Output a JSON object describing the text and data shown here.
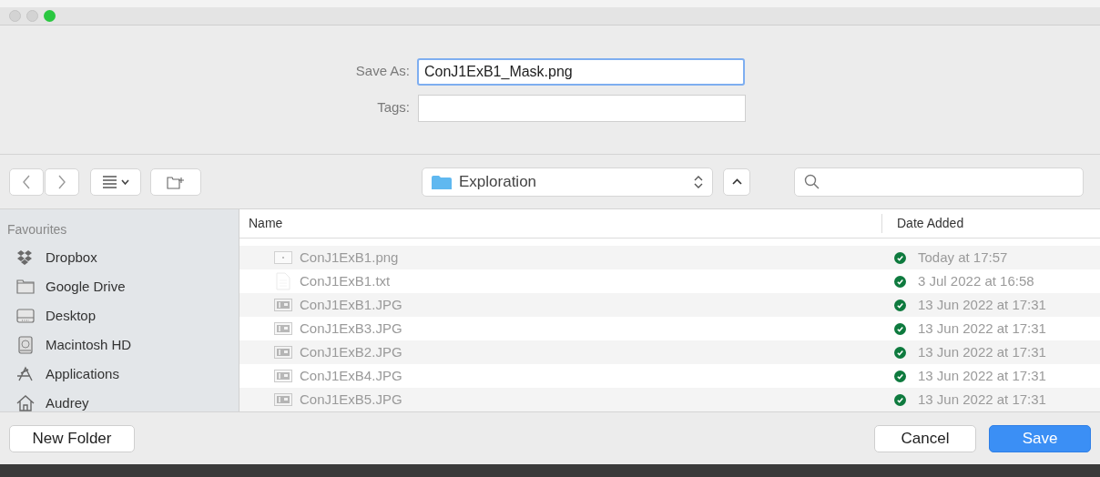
{
  "window": {
    "traffic_lights": [
      {
        "active": false
      },
      {
        "active": false
      },
      {
        "active": true
      }
    ]
  },
  "form": {
    "fields": [
      {
        "label": "Save As:",
        "value": "ConJ1ExB1_Mask.png",
        "focused": true
      },
      {
        "label": "Tags:",
        "focused": false
      }
    ]
  },
  "toolbar": {
    "location": "Exploration"
  },
  "sidebar": {
    "title": "Favourites",
    "items": [
      {
        "label": "Dropbox",
        "kind": "dropbox"
      },
      {
        "label": "Google Drive",
        "kind": "folder"
      },
      {
        "label": "Desktop",
        "kind": "desktop"
      },
      {
        "label": "Macintosh HD",
        "kind": "disk"
      },
      {
        "label": "Applications",
        "kind": "apps"
      },
      {
        "label": "Audrey",
        "kind": "home"
      }
    ]
  },
  "table": {
    "columns": [
      "Name",
      "Date Added"
    ],
    "rows": [
      {
        "name": "ConJ1ExB1.png",
        "kind": "png",
        "date": "Today at 17:57",
        "synced": true,
        "disabled": true
      },
      {
        "name": "ConJ1ExB1.txt",
        "kind": "txt",
        "date": "3 Jul 2022 at 16:58",
        "synced": true,
        "disabled": true
      },
      {
        "name": "ConJ1ExB1.JPG",
        "kind": "jpg",
        "date": "13 Jun 2022 at 17:31",
        "synced": true,
        "disabled": true
      },
      {
        "name": "ConJ1ExB3.JPG",
        "kind": "jpg",
        "date": "13 Jun 2022 at 17:31",
        "synced": true,
        "disabled": true
      },
      {
        "name": "ConJ1ExB2.JPG",
        "kind": "jpg",
        "date": "13 Jun 2022 at 17:31",
        "synced": true,
        "disabled": true
      },
      {
        "name": "ConJ1ExB4.JPG",
        "kind": "jpg",
        "date": "13 Jun 2022 at 17:31",
        "synced": true,
        "disabled": true
      },
      {
        "name": "ConJ1ExB5.JPG",
        "kind": "jpg",
        "date": "13 Jun 2022 at 17:31",
        "synced": true,
        "disabled": true
      }
    ]
  },
  "buttons": [
    {
      "label": "New Folder",
      "kind": "plain"
    },
    {
      "label": "Cancel",
      "kind": "plain"
    },
    {
      "label": "Save",
      "kind": "default"
    }
  ]
}
